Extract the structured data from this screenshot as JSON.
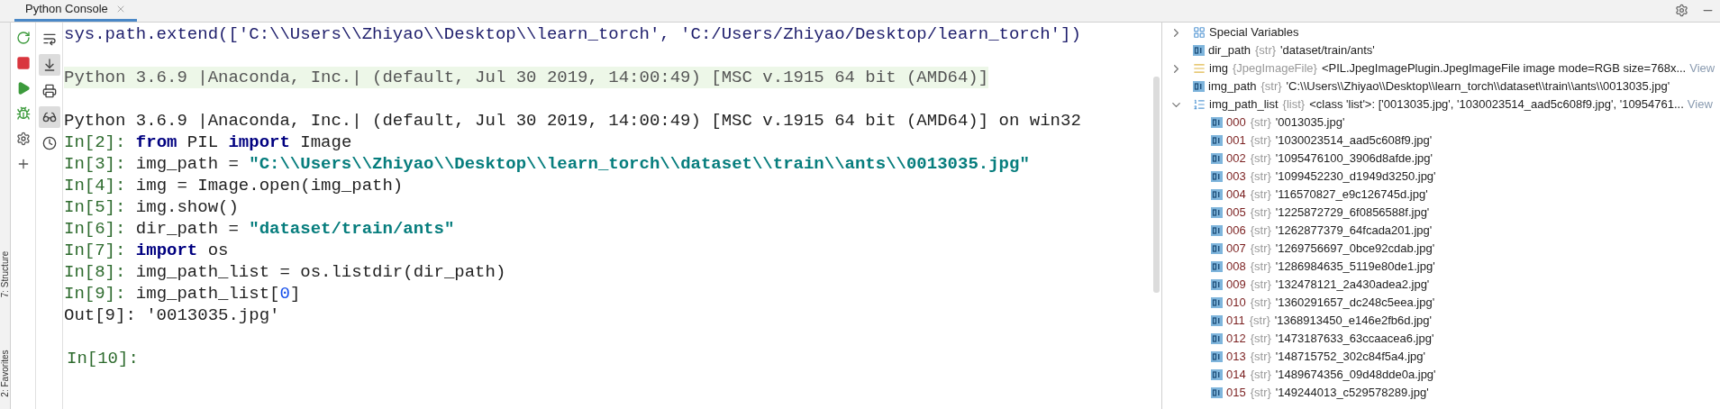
{
  "tab": {
    "label": "Python Console",
    "selected": true
  },
  "side_tabs": [
    "7: Structure",
    "2: Favorites"
  ],
  "toolbar": {
    "primary": [
      {
        "kind": "rerun"
      },
      {
        "kind": "stop"
      },
      {
        "kind": "run"
      },
      {
        "kind": "debug"
      },
      {
        "kind": "settings"
      },
      {
        "kind": "add"
      }
    ],
    "secondary": [
      {
        "kind": "wrap",
        "selected": false
      },
      {
        "kind": "scroll-end",
        "selected": true
      },
      {
        "kind": "print",
        "selected": false
      },
      {
        "kind": "glasses",
        "selected": true
      },
      {
        "kind": "history",
        "selected": false
      }
    ]
  },
  "console": {
    "lines": [
      {
        "kind": "command",
        "segments": [
          {
            "kind": "plain",
            "text": "sys.path.extend(['C:\\\\Users\\\\Zhiyao\\\\Desktop\\\\learn_torch', 'C:/Users/Zhiyao/Desktop/learn_torch'])"
          }
        ]
      },
      {
        "kind": "blank"
      },
      {
        "kind": "banner",
        "segments": [
          {
            "kind": "plain",
            "text": "Python 3.6.9 |Anaconda, Inc.| (default, Jul 30 2019, 14:00:49) [MSC v.1915 64 bit (AMD64)]"
          }
        ]
      },
      {
        "kind": "blank"
      },
      {
        "kind": "output",
        "segments": [
          {
            "kind": "plain",
            "text": "Python 3.6.9 |Anaconda, Inc.| (default, Jul 30 2019, 14:00:49) [MSC v.1915 64 bit (AMD64)] on win32"
          }
        ]
      },
      {
        "kind": "input",
        "prompt": "In[2]:",
        "segments": [
          {
            "kind": "keyword",
            "text": "from"
          },
          {
            "kind": "plain",
            "text": " PIL "
          },
          {
            "kind": "keyword",
            "text": "import"
          },
          {
            "kind": "plain",
            "text": " Image"
          }
        ]
      },
      {
        "kind": "input",
        "prompt": "In[3]:",
        "segments": [
          {
            "kind": "plain",
            "text": "img_path = "
          },
          {
            "kind": "string",
            "text": "\"C:\\\\Users\\\\Zhiyao\\\\Desktop\\\\learn_torch\\\\dataset\\\\train\\\\ants\\\\0013035.jpg\""
          }
        ]
      },
      {
        "kind": "input",
        "prompt": "In[4]:",
        "segments": [
          {
            "kind": "plain",
            "text": "img = Image.open(img_path)"
          }
        ]
      },
      {
        "kind": "input",
        "prompt": "In[5]:",
        "segments": [
          {
            "kind": "plain",
            "text": "img.show()"
          }
        ]
      },
      {
        "kind": "input",
        "prompt": "In[6]:",
        "segments": [
          {
            "kind": "plain",
            "text": "dir_path = "
          },
          {
            "kind": "string",
            "text": "\"dataset/train/ants\""
          }
        ]
      },
      {
        "kind": "input",
        "prompt": "In[7]:",
        "segments": [
          {
            "kind": "keyword",
            "text": "import"
          },
          {
            "kind": "plain",
            "text": " os"
          }
        ]
      },
      {
        "kind": "input",
        "prompt": "In[8]:",
        "segments": [
          {
            "kind": "plain",
            "text": "img_path_list = os.listdir(dir_path)"
          }
        ]
      },
      {
        "kind": "input",
        "prompt": "In[9]:",
        "segments": [
          {
            "kind": "plain",
            "text": "img_path_list["
          },
          {
            "kind": "number",
            "text": "0"
          },
          {
            "kind": "plain",
            "text": "]"
          }
        ]
      },
      {
        "kind": "output",
        "segments": [
          {
            "kind": "plain",
            "text": "Out[9]: '0013035.jpg'"
          }
        ]
      },
      {
        "kind": "blank"
      }
    ],
    "prompt": "In[10]:"
  },
  "variables": {
    "rows": [
      {
        "kind": "special",
        "name": "Special Variables",
        "expanded": false
      },
      {
        "kind": "str",
        "name": "dir_path",
        "type": "{str}",
        "value": "'dataset/train/ants'"
      },
      {
        "kind": "image",
        "name": "img",
        "type": "{JpegImageFile}",
        "value": "<PIL.JpegImagePlugin.JpegImageFile image mode=RGB size=768x...",
        "link": "View",
        "expanded": false
      },
      {
        "kind": "str",
        "name": "img_path",
        "type": "{str}",
        "value": "'C:\\\\Users\\\\Zhiyao\\\\Desktop\\\\learn_torch\\\\dataset\\\\train\\\\ants\\\\0013035.jpg'"
      },
      {
        "kind": "list",
        "name": "img_path_list",
        "type": "{list}",
        "value": "<class 'list'>: ['0013035.jpg', '1030023514_aad5c608f9.jpg', '10954761...",
        "link": "View",
        "expanded": true,
        "children": [
          {
            "kind": "str",
            "name": "000",
            "type": "{str}",
            "value": "'0013035.jpg'"
          },
          {
            "kind": "str",
            "name": "001",
            "type": "{str}",
            "value": "'1030023514_aad5c608f9.jpg'"
          },
          {
            "kind": "str",
            "name": "002",
            "type": "{str}",
            "value": "'1095476100_3906d8afde.jpg'"
          },
          {
            "kind": "str",
            "name": "003",
            "type": "{str}",
            "value": "'1099452230_d1949d3250.jpg'"
          },
          {
            "kind": "str",
            "name": "004",
            "type": "{str}",
            "value": "'116570827_e9c126745d.jpg'"
          },
          {
            "kind": "str",
            "name": "005",
            "type": "{str}",
            "value": "'1225872729_6f0856588f.jpg'"
          },
          {
            "kind": "str",
            "name": "006",
            "type": "{str}",
            "value": "'1262877379_64fcada201.jpg'"
          },
          {
            "kind": "str",
            "name": "007",
            "type": "{str}",
            "value": "'1269756697_0bce92cdab.jpg'"
          },
          {
            "kind": "str",
            "name": "008",
            "type": "{str}",
            "value": "'1286984635_5119e80de1.jpg'"
          },
          {
            "kind": "str",
            "name": "009",
            "type": "{str}",
            "value": "'132478121_2a430adea2.jpg'"
          },
          {
            "kind": "str",
            "name": "010",
            "type": "{str}",
            "value": "'1360291657_dc248c5eea.jpg'"
          },
          {
            "kind": "str",
            "name": "011",
            "type": "{str}",
            "value": "'1368913450_e146e2fb6d.jpg'"
          },
          {
            "kind": "str",
            "name": "012",
            "type": "{str}",
            "value": "'1473187633_63ccaacea6.jpg'"
          },
          {
            "kind": "str",
            "name": "013",
            "type": "{str}",
            "value": "'148715752_302c84f5a4.jpg'"
          },
          {
            "kind": "str",
            "name": "014",
            "type": "{str}",
            "value": "'1489674356_09d48dde0a.jpg'"
          },
          {
            "kind": "str",
            "name": "015",
            "type": "{str}",
            "value": "'149244013_c529578289.jpg'"
          }
        ]
      }
    ]
  }
}
